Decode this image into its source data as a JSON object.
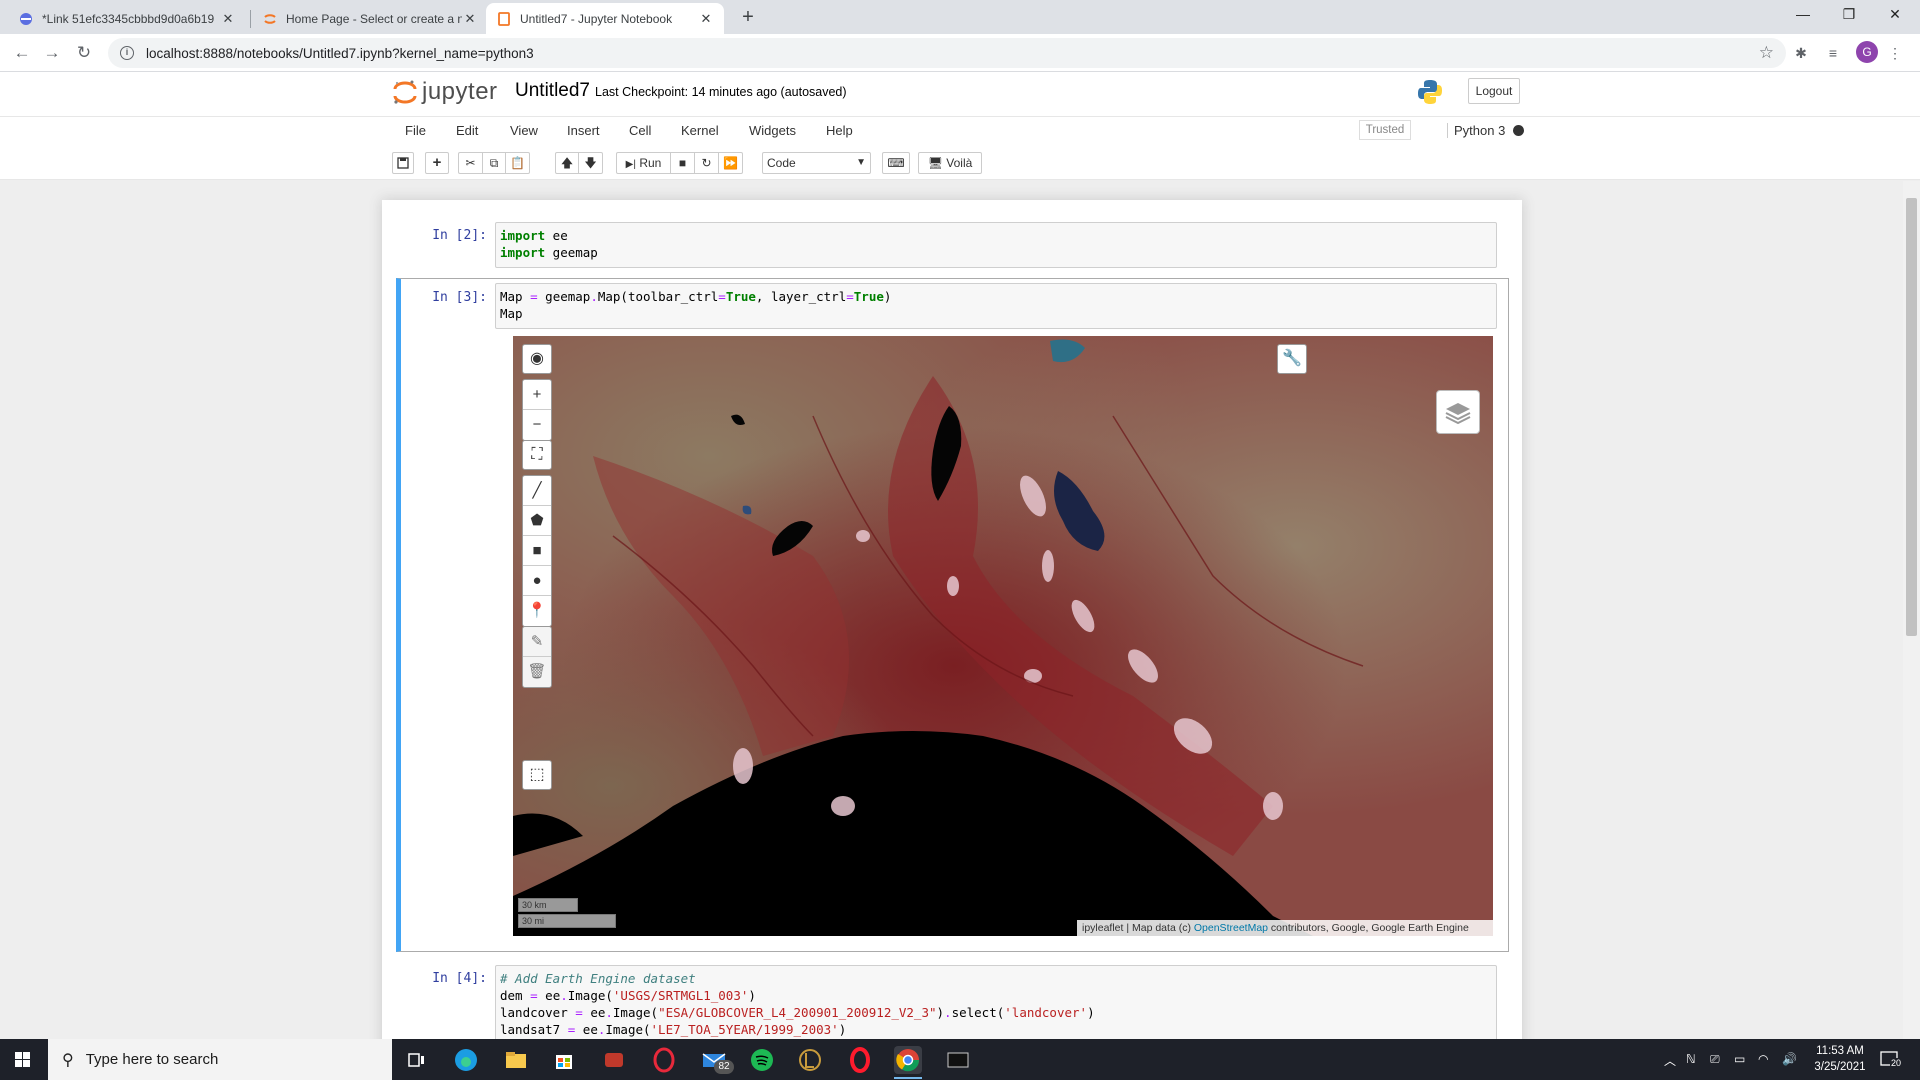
{
  "browser": {
    "tabs": [
      {
        "title": "*Link 51efc3345cbbbd9d0a6b19",
        "active": false
      },
      {
        "title": "Home Page - Select or create a n",
        "active": false
      },
      {
        "title": "Untitled7 - Jupyter Notebook",
        "active": true
      }
    ],
    "new_tab": "+",
    "url": "localhost:8888/notebooks/Untitled7.ipynb?kernel_name=python3",
    "profile_initial": "G"
  },
  "jupyter": {
    "logo_text": "jupyter",
    "notebook_name": "Untitled7",
    "checkpoint": "Last Checkpoint: 14 minutes ago  (autosaved)",
    "logout_label": "Logout",
    "menu": [
      "File",
      "Edit",
      "View",
      "Insert",
      "Cell",
      "Kernel",
      "Widgets",
      "Help"
    ],
    "trusted_label": "Trusted",
    "kernel_name": "Python 3",
    "toolbar": {
      "run_label": "Run",
      "cell_type": "Code",
      "voila_label": "Voilà"
    }
  },
  "cells": [
    {
      "prompt": "In [2]:"
    },
    {
      "prompt": "In [3]:"
    },
    {
      "prompt": "In [4]:"
    }
  ],
  "map": {
    "scale_km": "30 km",
    "scale_mi": "30 mi",
    "attribution_pre": "ipyleaflet | Map data (c) ",
    "attribution_link": "OpenStreetMap",
    "attribution_post": " contributors, Google, Google Earth Engine"
  },
  "taskbar": {
    "search_placeholder": "Type here to search",
    "mail_badge": "82",
    "time": "11:53 AM",
    "date": "3/25/2021",
    "notifications": "20"
  }
}
